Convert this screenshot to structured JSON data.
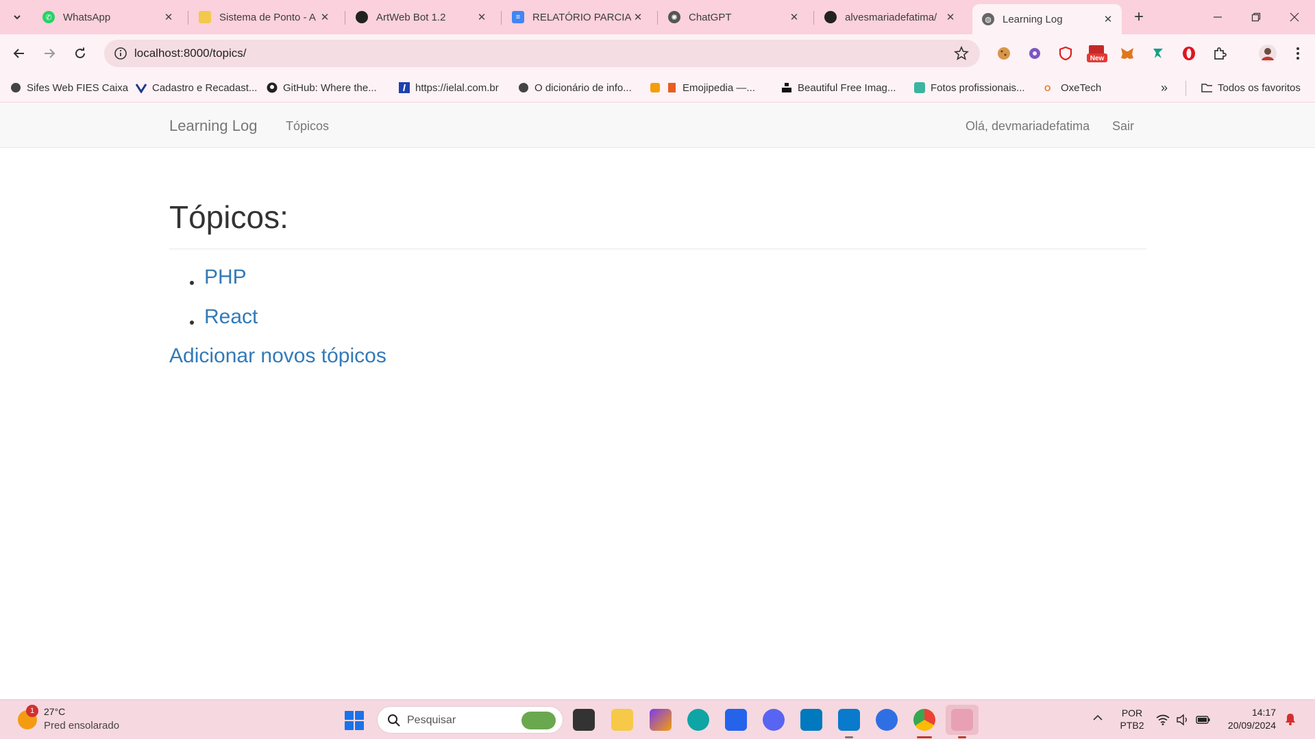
{
  "browser": {
    "tabs": [
      {
        "title": "WhatsApp",
        "icon": "whatsapp-icon",
        "color": "#25d366"
      },
      {
        "title": "Sistema de Ponto - A",
        "icon": "ponto-icon",
        "color": "#f2c94c"
      },
      {
        "title": "ArtWeb Bot 1.2",
        "icon": "artweb-icon",
        "color": "#222222"
      },
      {
        "title": "RELATÓRIO PARCIAL",
        "icon": "google-docs-icon",
        "color": "#4285f4"
      },
      {
        "title": "ChatGPT",
        "icon": "chatgpt-icon",
        "color": "#555555"
      },
      {
        "title": "alvesmariadefatima/",
        "icon": "github-icon",
        "color": "#222222"
      },
      {
        "title": "Learning Log",
        "icon": "globe-icon",
        "color": "#666666"
      }
    ],
    "url": "localhost:8000/topics/",
    "bookmarks": [
      {
        "label": "Sifes Web FIES Caixa",
        "icon": "globe-icon"
      },
      {
        "label": "Cadastro e Recadast...",
        "icon": "v-logo-icon"
      },
      {
        "label": "GitHub: Where the...",
        "icon": "github-icon"
      },
      {
        "label": "https://ielal.com.br",
        "icon": "ielal-icon"
      },
      {
        "label": "O dicionário de info...",
        "icon": "globe-icon"
      },
      {
        "label": "Emojipedia —...",
        "icon": "emojipedia-icon"
      },
      {
        "label": "Beautiful Free Imag...",
        "icon": "unsplash-icon"
      },
      {
        "label": "Fotos profissionais...",
        "icon": "pexels-icon"
      },
      {
        "label": "OxeTech",
        "icon": "oxetech-icon"
      }
    ],
    "all_bookmarks_label": "Todos os favoritos",
    "extension_new_badge": "New"
  },
  "navbar": {
    "brand": "Learning Log",
    "topics_link": "Tópicos",
    "greeting": "Olá, devmariadefatima",
    "logout": "Sair"
  },
  "main": {
    "title": "Tópicos:",
    "topics": [
      "PHP",
      "React"
    ],
    "add_link": "Adicionar novos tópicos"
  },
  "taskbar": {
    "weather_badge": "1",
    "temperature": "27°C",
    "weather_desc": "Pred ensolarado",
    "search_placeholder": "Pesquisar",
    "lang_line1": "POR",
    "lang_line2": "PTB2",
    "time": "14:17",
    "date": "20/09/2024"
  },
  "colors": {
    "link": "#337ab7",
    "tabstrip": "#fad1dc",
    "toolbar": "#fdf2f5",
    "navbar_bg": "#f8f8f8",
    "taskbar": "#f6d8e0"
  }
}
